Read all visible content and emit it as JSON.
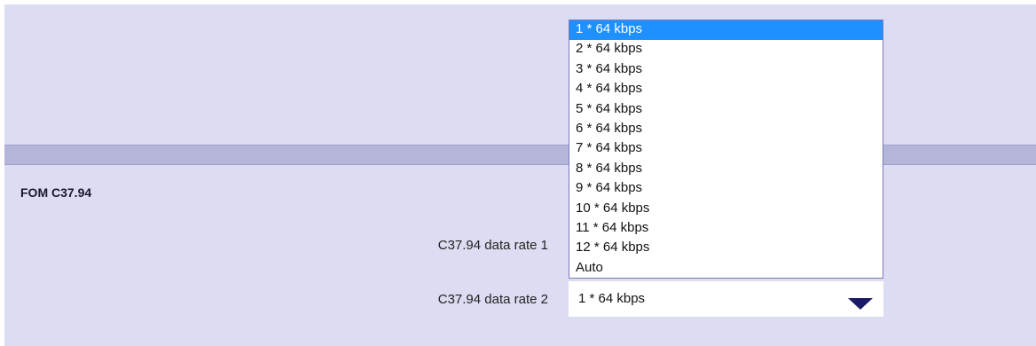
{
  "section": {
    "title": "FOM C37.94"
  },
  "fields": {
    "rate1_label": "C37.94 data rate 1",
    "rate2_label": "C37.94 data rate 2",
    "rate2_value": "1 * 64 kbps"
  },
  "dropdown": {
    "options": [
      "1 * 64 kbps",
      "2 * 64 kbps",
      "3 * 64 kbps",
      "4 * 64 kbps",
      "5 * 64 kbps",
      "6 * 64 kbps",
      "7 * 64 kbps",
      "8 * 64 kbps",
      "9 * 64 kbps",
      "10 * 64 kbps",
      "11 * 64 kbps",
      "12 * 64 kbps",
      "Auto"
    ],
    "highlighted_option": "1 * 64 kbps"
  },
  "colors": {
    "background": "#dcdcf2",
    "band": "#b5b5d9",
    "highlight": "#1e90ff",
    "caret": "#1a1a66"
  },
  "icons": {
    "caret": "chevron-down-icon"
  }
}
